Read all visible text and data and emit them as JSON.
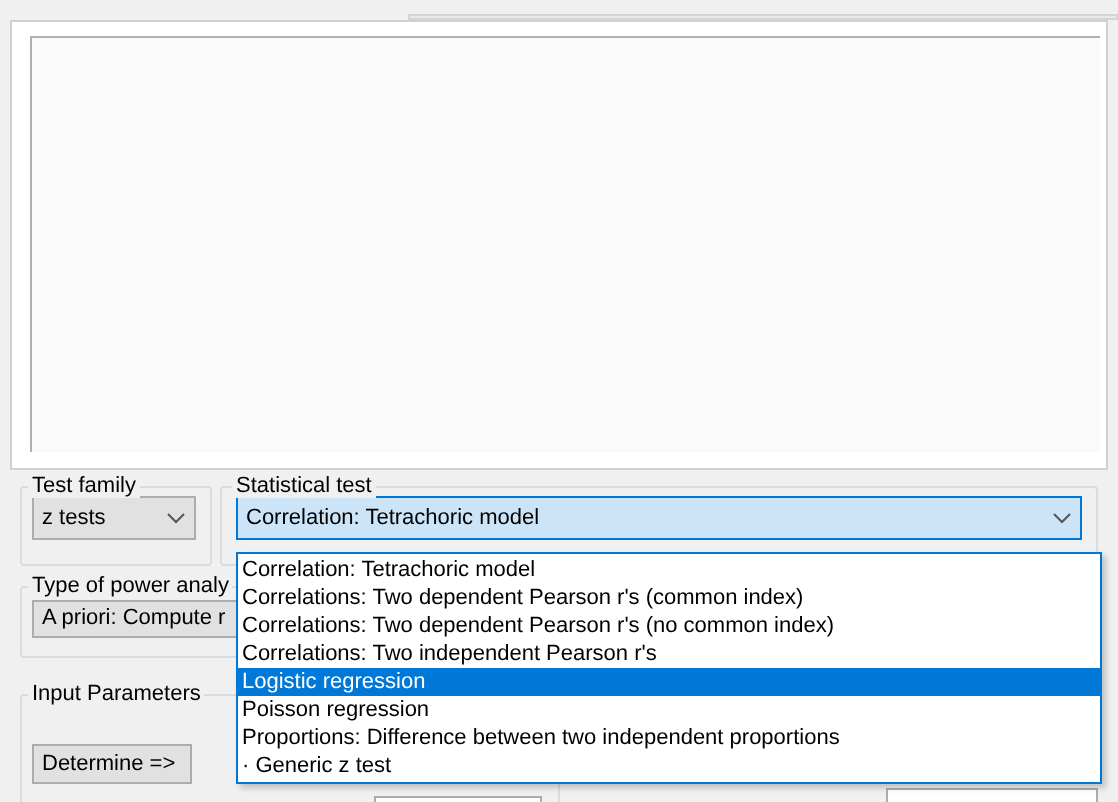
{
  "test_family": {
    "label": "Test family",
    "value": "z tests"
  },
  "statistical_test": {
    "label": "Statistical test",
    "value": "Correlation: Tetrachoric model",
    "expanded": true,
    "options": [
      {
        "label": "Correlation: Tetrachoric model",
        "highlighted": false
      },
      {
        "label": "Correlations: Two dependent Pearson r's (common index)",
        "highlighted": false
      },
      {
        "label": "Correlations: Two dependent Pearson r's (no common index)",
        "highlighted": false
      },
      {
        "label": "Correlations: Two independent Pearson r's",
        "highlighted": false
      },
      {
        "label": "Logistic regression",
        "highlighted": true
      },
      {
        "label": "Poisson regression",
        "highlighted": false
      },
      {
        "label": "Proportions: Difference between two independent proportions",
        "highlighted": false
      },
      {
        "label": "· Generic z test",
        "highlighted": false
      }
    ]
  },
  "power_analysis": {
    "label": "Type of power analy",
    "value": "A priori: Compute r"
  },
  "input_parameters": {
    "label": "Input Parameters"
  },
  "determine_button": "Determine =>"
}
